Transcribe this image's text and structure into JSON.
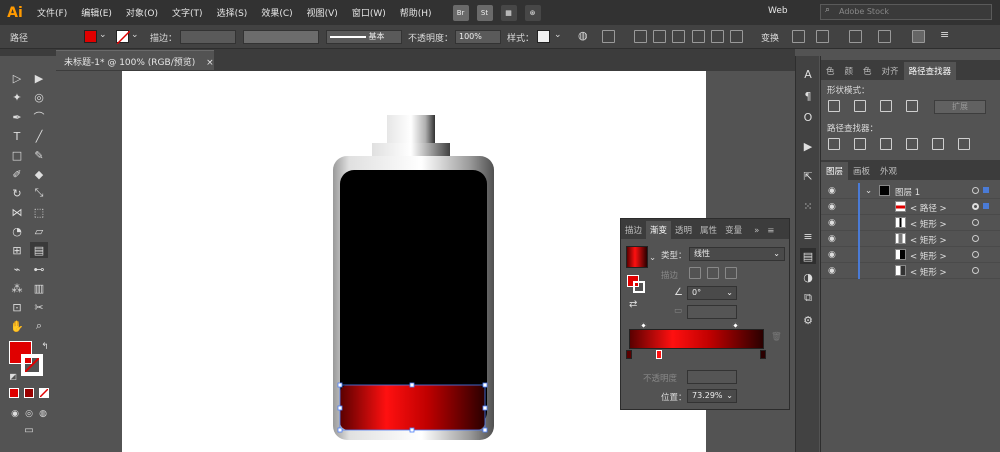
{
  "menubar": {
    "logo": "Ai",
    "items": [
      "文件(F)",
      "编辑(E)",
      "对象(O)",
      "文字(T)",
      "选择(S)",
      "效果(C)",
      "视图(V)",
      "窗口(W)",
      "帮助(H)"
    ],
    "bridge": "Br",
    "stock": "St",
    "workspace": "Web",
    "search_placeholder": "Adobe Stock"
  },
  "controlbar": {
    "object_type": "路径",
    "stroke_label": "描边：",
    "stroke_style": "基本",
    "opacity_label": "不透明度：",
    "opacity_value": "100%",
    "style_label": "样式：",
    "transform_label": "变换",
    "fill_color": "#e00000"
  },
  "document": {
    "tab_title": "未标题-1* @ 100% (RGB/预览)",
    "close": "×"
  },
  "toolbar": {
    "fill_color": "#e00000"
  },
  "right_panel": {
    "tabs": [
      "色",
      "颜",
      "色",
      "对齐",
      "路径查找器"
    ],
    "shape_modes_label": "形状模式：",
    "pathfinder_label": "路径查找器：",
    "expand_label": "扩展",
    "layers_tabs": [
      "图层",
      "画板",
      "外观"
    ],
    "layers": [
      {
        "name": "图层 1",
        "kind": "layer"
      },
      {
        "name": "< 路径 >",
        "kind": "path"
      },
      {
        "name": "< 矩形 >",
        "kind": "rect"
      },
      {
        "name": "< 矩形 >",
        "kind": "rect"
      },
      {
        "name": "< 矩形 >",
        "kind": "rect"
      },
      {
        "name": "< 矩形 >",
        "kind": "rect"
      }
    ]
  },
  "gradient_panel": {
    "tabs": [
      "描边",
      "渐变",
      "透明",
      "属性",
      "变量"
    ],
    "type_label": "类型：",
    "type_value": "线性",
    "stroke_label": "描边",
    "angle_value": "0°",
    "opacity_label": "不透明度",
    "location_label": "位置：",
    "location_value": "73.29%",
    "menu": "»",
    "stops_colors": [
      "#5a0000",
      "#ff1010",
      "#2a0000"
    ]
  }
}
